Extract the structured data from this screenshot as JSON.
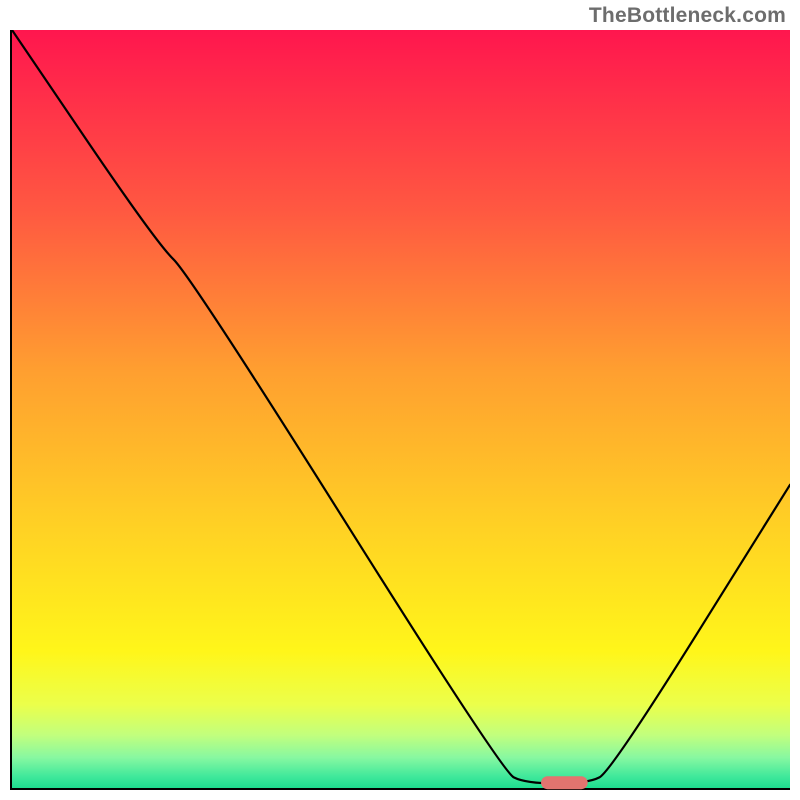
{
  "watermark": "TheBottleneck.com",
  "chart_data": {
    "type": "line",
    "title": "",
    "xlabel": "",
    "ylabel": "",
    "x_range": [
      0,
      100
    ],
    "y_range": [
      0,
      100
    ],
    "grid": false,
    "legend": "none",
    "axis_border": {
      "left": true,
      "bottom": true,
      "right": false,
      "top": false
    },
    "gradient_background": {
      "direction": "vertical",
      "stops": [
        {
          "pos": 0.0,
          "color": "#ff164e"
        },
        {
          "pos": 0.24,
          "color": "#ff5941"
        },
        {
          "pos": 0.45,
          "color": "#ff9f30"
        },
        {
          "pos": 0.66,
          "color": "#ffd224"
        },
        {
          "pos": 0.82,
          "color": "#fff61a"
        },
        {
          "pos": 0.89,
          "color": "#ebff4b"
        },
        {
          "pos": 0.93,
          "color": "#c2ff7d"
        },
        {
          "pos": 0.96,
          "color": "#87f8a1"
        },
        {
          "pos": 0.985,
          "color": "#3fe89b"
        },
        {
          "pos": 1.0,
          "color": "#1edc8f"
        }
      ]
    },
    "curve": [
      {
        "x": 0.0,
        "y": 100.0
      },
      {
        "x": 18.5,
        "y": 72.0
      },
      {
        "x": 23.0,
        "y": 67.5
      },
      {
        "x": 63.0,
        "y": 2.2
      },
      {
        "x": 66.0,
        "y": 0.6
      },
      {
        "x": 74.0,
        "y": 0.6
      },
      {
        "x": 77.0,
        "y": 2.2
      },
      {
        "x": 100.0,
        "y": 40.0
      }
    ],
    "marker": {
      "x_start": 68.0,
      "x_end": 74.0,
      "y": 0.7,
      "color": "#e2746f"
    }
  }
}
